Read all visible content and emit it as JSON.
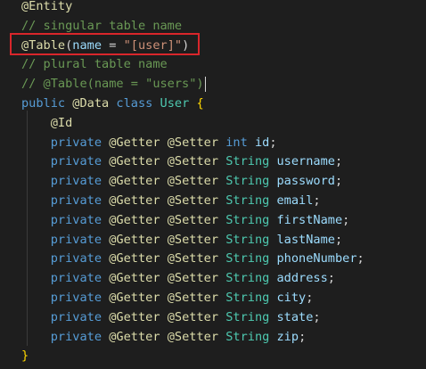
{
  "editor": {
    "lines": [
      [
        {
          "t": "@Entity",
          "k": "anno"
        }
      ],
      [
        {
          "t": "// singular table name",
          "k": "comment"
        }
      ],
      [
        {
          "t": "@Table",
          "k": "anno"
        },
        {
          "t": "(",
          "k": "punc"
        },
        {
          "t": "name",
          "k": "var"
        },
        {
          "t": " = ",
          "k": "punc"
        },
        {
          "t": "\"[user]\"",
          "k": "str"
        },
        {
          "t": ")",
          "k": "punc"
        }
      ],
      [
        {
          "t": "// plural table name",
          "k": "comment"
        }
      ],
      [
        {
          "t": "// @Table(name = \"users\")",
          "k": "comment"
        }
      ],
      [
        {
          "t": "public",
          "k": "kw"
        },
        {
          "t": " ",
          "k": "punc"
        },
        {
          "t": "@Data",
          "k": "anno"
        },
        {
          "t": " ",
          "k": "punc"
        },
        {
          "t": "class",
          "k": "kw"
        },
        {
          "t": " ",
          "k": "punc"
        },
        {
          "t": "User",
          "k": "type"
        },
        {
          "t": " ",
          "k": "punc"
        },
        {
          "t": "{",
          "k": "brace"
        }
      ],
      [
        {
          "t": "    ",
          "k": "punc"
        },
        {
          "t": "@Id",
          "k": "anno"
        }
      ],
      [
        {
          "t": "    ",
          "k": "punc"
        },
        {
          "t": "private",
          "k": "kw"
        },
        {
          "t": " ",
          "k": "punc"
        },
        {
          "t": "@Getter",
          "k": "anno"
        },
        {
          "t": " ",
          "k": "punc"
        },
        {
          "t": "@Setter",
          "k": "anno"
        },
        {
          "t": " ",
          "k": "punc"
        },
        {
          "t": "int",
          "k": "kw"
        },
        {
          "t": " ",
          "k": "punc"
        },
        {
          "t": "id",
          "k": "var"
        },
        {
          "t": ";",
          "k": "punc"
        }
      ],
      [
        {
          "t": "    ",
          "k": "punc"
        },
        {
          "t": "private",
          "k": "kw"
        },
        {
          "t": " ",
          "k": "punc"
        },
        {
          "t": "@Getter",
          "k": "anno"
        },
        {
          "t": " ",
          "k": "punc"
        },
        {
          "t": "@Setter",
          "k": "anno"
        },
        {
          "t": " ",
          "k": "punc"
        },
        {
          "t": "String",
          "k": "type"
        },
        {
          "t": " ",
          "k": "punc"
        },
        {
          "t": "username",
          "k": "var"
        },
        {
          "t": ";",
          "k": "punc"
        }
      ],
      [
        {
          "t": "    ",
          "k": "punc"
        },
        {
          "t": "private",
          "k": "kw"
        },
        {
          "t": " ",
          "k": "punc"
        },
        {
          "t": "@Getter",
          "k": "anno"
        },
        {
          "t": " ",
          "k": "punc"
        },
        {
          "t": "@Setter",
          "k": "anno"
        },
        {
          "t": " ",
          "k": "punc"
        },
        {
          "t": "String",
          "k": "type"
        },
        {
          "t": " ",
          "k": "punc"
        },
        {
          "t": "password",
          "k": "var"
        },
        {
          "t": ";",
          "k": "punc"
        }
      ],
      [
        {
          "t": "    ",
          "k": "punc"
        },
        {
          "t": "private",
          "k": "kw"
        },
        {
          "t": " ",
          "k": "punc"
        },
        {
          "t": "@Getter",
          "k": "anno"
        },
        {
          "t": " ",
          "k": "punc"
        },
        {
          "t": "@Setter",
          "k": "anno"
        },
        {
          "t": " ",
          "k": "punc"
        },
        {
          "t": "String",
          "k": "type"
        },
        {
          "t": " ",
          "k": "punc"
        },
        {
          "t": "email",
          "k": "var"
        },
        {
          "t": ";",
          "k": "punc"
        }
      ],
      [
        {
          "t": "    ",
          "k": "punc"
        },
        {
          "t": "private",
          "k": "kw"
        },
        {
          "t": " ",
          "k": "punc"
        },
        {
          "t": "@Getter",
          "k": "anno"
        },
        {
          "t": " ",
          "k": "punc"
        },
        {
          "t": "@Setter",
          "k": "anno"
        },
        {
          "t": " ",
          "k": "punc"
        },
        {
          "t": "String",
          "k": "type"
        },
        {
          "t": " ",
          "k": "punc"
        },
        {
          "t": "firstName",
          "k": "var"
        },
        {
          "t": ";",
          "k": "punc"
        }
      ],
      [
        {
          "t": "    ",
          "k": "punc"
        },
        {
          "t": "private",
          "k": "kw"
        },
        {
          "t": " ",
          "k": "punc"
        },
        {
          "t": "@Getter",
          "k": "anno"
        },
        {
          "t": " ",
          "k": "punc"
        },
        {
          "t": "@Setter",
          "k": "anno"
        },
        {
          "t": " ",
          "k": "punc"
        },
        {
          "t": "String",
          "k": "type"
        },
        {
          "t": " ",
          "k": "punc"
        },
        {
          "t": "lastName",
          "k": "var"
        },
        {
          "t": ";",
          "k": "punc"
        }
      ],
      [
        {
          "t": "    ",
          "k": "punc"
        },
        {
          "t": "private",
          "k": "kw"
        },
        {
          "t": " ",
          "k": "punc"
        },
        {
          "t": "@Getter",
          "k": "anno"
        },
        {
          "t": " ",
          "k": "punc"
        },
        {
          "t": "@Setter",
          "k": "anno"
        },
        {
          "t": " ",
          "k": "punc"
        },
        {
          "t": "String",
          "k": "type"
        },
        {
          "t": " ",
          "k": "punc"
        },
        {
          "t": "phoneNumber",
          "k": "var"
        },
        {
          "t": ";",
          "k": "punc"
        }
      ],
      [
        {
          "t": "    ",
          "k": "punc"
        },
        {
          "t": "private",
          "k": "kw"
        },
        {
          "t": " ",
          "k": "punc"
        },
        {
          "t": "@Getter",
          "k": "anno"
        },
        {
          "t": " ",
          "k": "punc"
        },
        {
          "t": "@Setter",
          "k": "anno"
        },
        {
          "t": " ",
          "k": "punc"
        },
        {
          "t": "String",
          "k": "type"
        },
        {
          "t": " ",
          "k": "punc"
        },
        {
          "t": "address",
          "k": "var"
        },
        {
          "t": ";",
          "k": "punc"
        }
      ],
      [
        {
          "t": "    ",
          "k": "punc"
        },
        {
          "t": "private",
          "k": "kw"
        },
        {
          "t": " ",
          "k": "punc"
        },
        {
          "t": "@Getter",
          "k": "anno"
        },
        {
          "t": " ",
          "k": "punc"
        },
        {
          "t": "@Setter",
          "k": "anno"
        },
        {
          "t": " ",
          "k": "punc"
        },
        {
          "t": "String",
          "k": "type"
        },
        {
          "t": " ",
          "k": "punc"
        },
        {
          "t": "city",
          "k": "var"
        },
        {
          "t": ";",
          "k": "punc"
        }
      ],
      [
        {
          "t": "    ",
          "k": "punc"
        },
        {
          "t": "private",
          "k": "kw"
        },
        {
          "t": " ",
          "k": "punc"
        },
        {
          "t": "@Getter",
          "k": "anno"
        },
        {
          "t": " ",
          "k": "punc"
        },
        {
          "t": "@Setter",
          "k": "anno"
        },
        {
          "t": " ",
          "k": "punc"
        },
        {
          "t": "String",
          "k": "type"
        },
        {
          "t": " ",
          "k": "punc"
        },
        {
          "t": "state",
          "k": "var"
        },
        {
          "t": ";",
          "k": "punc"
        }
      ],
      [
        {
          "t": "    ",
          "k": "punc"
        },
        {
          "t": "private",
          "k": "kw"
        },
        {
          "t": " ",
          "k": "punc"
        },
        {
          "t": "@Getter",
          "k": "anno"
        },
        {
          "t": " ",
          "k": "punc"
        },
        {
          "t": "@Setter",
          "k": "anno"
        },
        {
          "t": " ",
          "k": "punc"
        },
        {
          "t": "String",
          "k": "type"
        },
        {
          "t": " ",
          "k": "punc"
        },
        {
          "t": "zip",
          "k": "var"
        },
        {
          "t": ";",
          "k": "punc"
        }
      ],
      [
        {
          "t": "}",
          "k": "brace"
        }
      ]
    ],
    "cursor_line": 4,
    "highlighted_line": 2,
    "colors": {
      "background": "#1e1e1e",
      "annotation": "#dcdcaa",
      "comment": "#6a9955",
      "keyword": "#569cd6",
      "type": "#4ec9b0",
      "variable": "#9cdcfe",
      "string": "#ce9178",
      "brace": "#ffd700",
      "highlight_box": "#d9262b"
    }
  }
}
